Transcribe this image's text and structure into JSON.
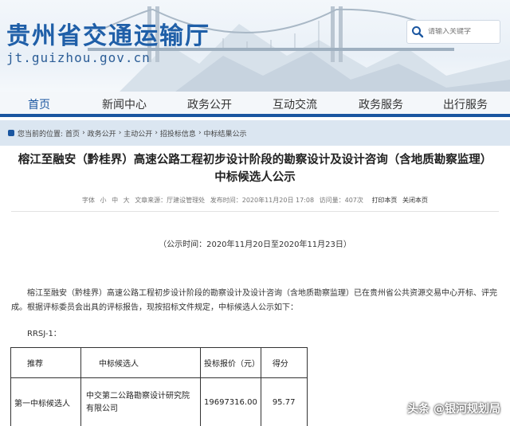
{
  "header": {
    "site_title": "贵州省交通运输厅",
    "site_url": "jt.guizhou.gov.cn",
    "search_placeholder": "请输入关键字",
    "search_icon": "search-icon"
  },
  "nav": {
    "items": [
      {
        "label": "首页",
        "active": true
      },
      {
        "label": "新闻中心"
      },
      {
        "label": "政务公开"
      },
      {
        "label": "互动交流"
      },
      {
        "label": "政务服务"
      },
      {
        "label": "出行服务"
      }
    ]
  },
  "breadcrumb": {
    "prefix": "您当前的位置:",
    "items": [
      "首页",
      "政务公开",
      "主动公开",
      "招投标信息",
      "中标结果公示"
    ],
    "separator": "›"
  },
  "article": {
    "title_line1": "榕江至融安（黔桂界）高速公路工程初步设计阶段的勘察设计及设计咨询（含地质勘察监理）",
    "title_line2": "中标候选人公示",
    "meta": {
      "font_label": "字体",
      "font_small": "小",
      "font_medium": "中",
      "font_large": "大",
      "source": "文章来源：厅建设管理处",
      "date": "发布时间：2020年11月20日 17:08",
      "visits": "访问量：407次",
      "print": "打印本页",
      "close": "关闭本页"
    },
    "period": "（公示时间：2020年11月20日至2020年11月23日）",
    "paragraph": "榕江至融安（黔桂界）高速公路工程初步设计阶段的勘察设计及设计咨询（含地质勘察监理）已在贵州省公共资源交易中心开标、评完成。根据评标委员会出具的评标报告，现按招标文件规定，中标候选人公示如下：",
    "section_code": "RRSJ-1："
  },
  "table": {
    "headers": [
      "推荐",
      "中标候选人",
      "投标报价（元）",
      "得分"
    ],
    "rows": [
      {
        "rank": "第一中标候选人",
        "candidate": "中交第二公路勘察设计研究院有限公司",
        "price": "19697316.00",
        "score": "95.77"
      }
    ]
  },
  "watermark": "头条 @银河规划局"
}
